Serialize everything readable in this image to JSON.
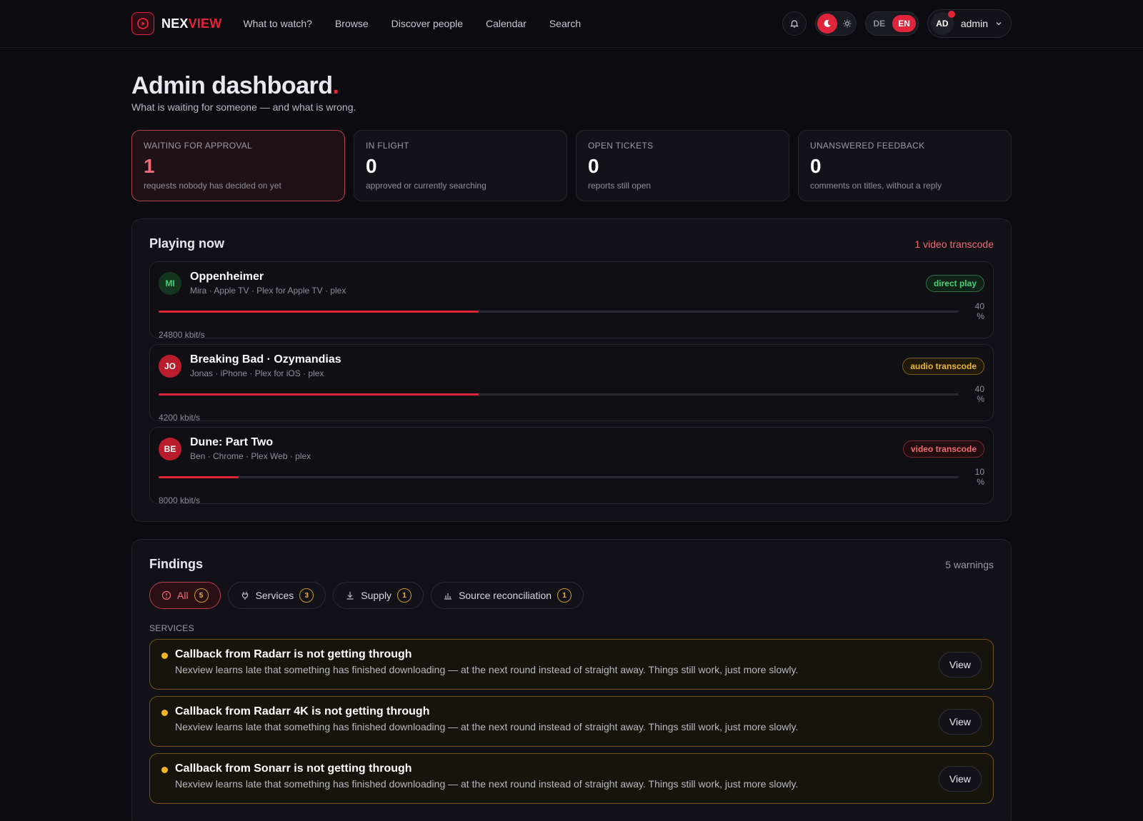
{
  "brand": {
    "name_a": "NEX",
    "name_b": "VIEW"
  },
  "nav": [
    "What to watch?",
    "Browse",
    "Discover people",
    "Calendar",
    "Search"
  ],
  "lang": {
    "de": "DE",
    "en": "EN"
  },
  "user": {
    "initials": "AD",
    "name": "admin"
  },
  "page": {
    "title": "Admin dashboard",
    "title_dot": ".",
    "subtitle": "What is waiting for someone — and what is wrong."
  },
  "stats": [
    {
      "label": "WAITING FOR APPROVAL",
      "value": "1",
      "desc": "requests nobody has decided on yet"
    },
    {
      "label": "IN FLIGHT",
      "value": "0",
      "desc": "approved or currently searching"
    },
    {
      "label": "OPEN TICKETS",
      "value": "0",
      "desc": "reports still open"
    },
    {
      "label": "UNANSWERED FEEDBACK",
      "value": "0",
      "desc": "comments on titles, without a reply"
    }
  ],
  "playing": {
    "title": "Playing now",
    "meta": "1 video transcode",
    "sessions": [
      {
        "initials": "MI",
        "title": "Oppenheimer",
        "sub": "Mira · Apple TV · Plex for Apple TV · plex",
        "badge": "direct play",
        "progress": 40,
        "pct": "40 %",
        "rate": "24800 kbit/s"
      },
      {
        "initials": "JO",
        "title": "Breaking Bad · Ozymandias",
        "sub": "Jonas · iPhone · Plex for iOS · plex",
        "badge": "audio transcode",
        "progress": 40,
        "pct": "40 %",
        "rate": "4200 kbit/s"
      },
      {
        "initials": "BE",
        "title": "Dune: Part Two",
        "sub": "Ben · Chrome · Plex Web · plex",
        "badge": "video transcode",
        "progress": 10,
        "pct": "10 %",
        "rate": "8000 kbit/s"
      }
    ]
  },
  "findings": {
    "title": "Findings",
    "meta": "5 warnings",
    "tabs": [
      {
        "label": "All",
        "count": "5"
      },
      {
        "label": "Services",
        "count": "3"
      },
      {
        "label": "Supply",
        "count": "1"
      },
      {
        "label": "Source reconciliation",
        "count": "1"
      }
    ],
    "section": "SERVICES",
    "view_label": "View",
    "items": [
      {
        "title": "Callback from Radarr is not getting through",
        "desc": "Nexview learns late that something has finished downloading — at the next round instead of straight away. Things still work, just more slowly."
      },
      {
        "title": "Callback from Radarr 4K is not getting through",
        "desc": "Nexview learns late that something has finished downloading — at the next round instead of straight away. Things still work, just more slowly."
      },
      {
        "title": "Callback from Sonarr is not getting through",
        "desc": "Nexview learns late that something has finished downloading — at the next round instead of straight away. Things still work, just more slowly."
      }
    ]
  },
  "colors": {
    "accent": "#e0243a",
    "warning": "#f0b528",
    "success": "#4bd07a"
  }
}
